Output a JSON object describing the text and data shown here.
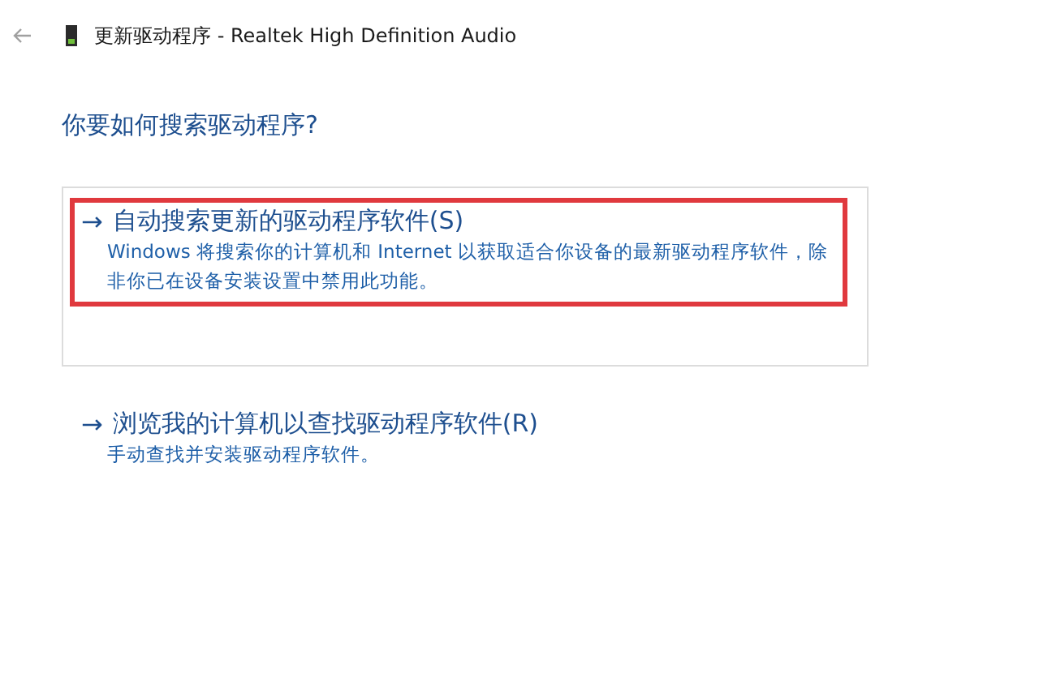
{
  "window": {
    "title": "更新驱动程序 - Realtek High Definition Audio"
  },
  "heading": "你要如何搜索驱动程序?",
  "options": [
    {
      "arrow": "→",
      "title": "自动搜索更新的驱动程序软件(S)",
      "description": "Windows 将搜索你的计算机和 Internet 以获取适合你设备的最新驱动程序软件，除非你已在设备安装设置中禁用此功能。",
      "selected": true,
      "highlighted": true
    },
    {
      "arrow": "→",
      "title": "浏览我的计算机以查找驱动程序软件(R)",
      "description": "手动查找并安装驱动程序软件。",
      "selected": false,
      "highlighted": false
    }
  ]
}
